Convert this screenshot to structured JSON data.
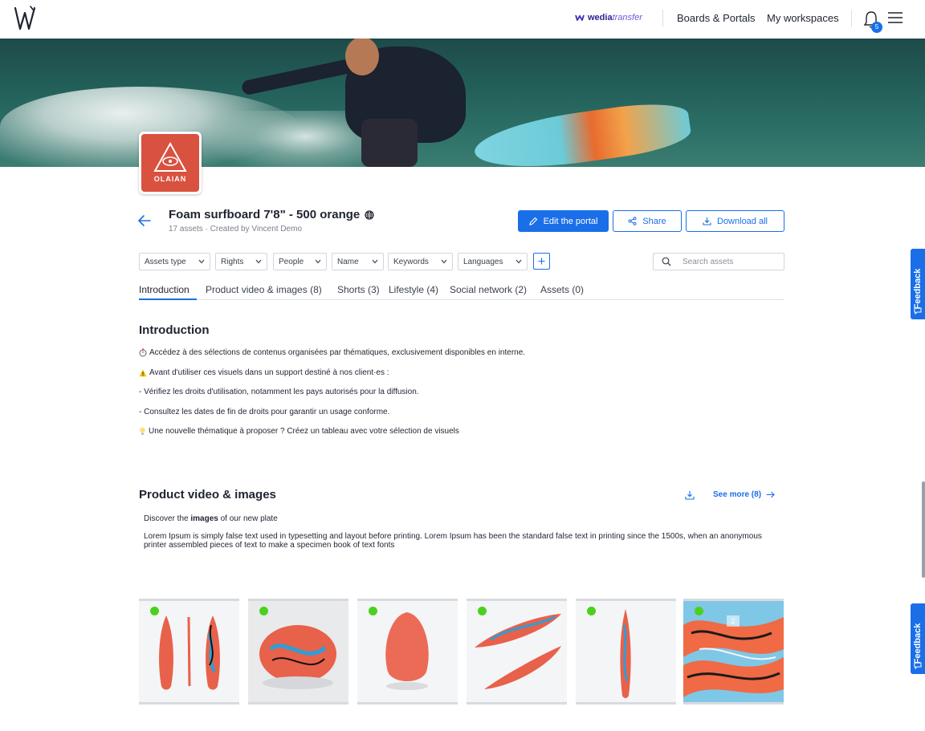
{
  "topbar": {
    "brand_a": "wedia",
    "brand_b": "transfer",
    "nav": [
      "Boards & Portals",
      "My workspaces"
    ],
    "notification_count": "5"
  },
  "portal": {
    "logo_text": "OLAIAN",
    "title": "Foam surfboard 7'8\" - 500 orange",
    "subtitle": "17 assets · Created by Vincent Demo"
  },
  "actions": {
    "edit": "Edit the portal",
    "share": "Share",
    "download": "Download all"
  },
  "filters": [
    "Assets type",
    "Rights",
    "People",
    "Name",
    "Keywords",
    "Languages"
  ],
  "search": {
    "placeholder": "Search assets"
  },
  "tabs": [
    "Introduction",
    "Product video & images (8)",
    "Shorts (3)",
    "Lifestyle (4)",
    "Social network (2)",
    "Assets (0)"
  ],
  "intro": {
    "heading": "Introduction",
    "lines": [
      "Accédez à des sélections de contenus organisées par thématiques, exclusivement disponibles en interne.",
      "Avant d'utiliser ces visuels dans un support destiné à nos client·es :",
      "- Vérifiez les droits d'utilisation, notamment les pays autorisés pour la diffusion.",
      "- Consultez les dates de fin de droits pour garantir un usage conforme.",
      "Une nouvelle thématique à proposer ? Créez un tableau avec votre sélection de visuels"
    ]
  },
  "product": {
    "heading": "Product video & images",
    "see_more": "See more (8)",
    "desc_prefix": "Discover the ",
    "desc_bold": "images",
    "desc_suffix": " of our new plate",
    "lorem": "Lorem Ipsum is simply false text used in typesetting and layout before printing. Lorem Ipsum has been the standard false text in printing since the 1500s, when an anonymous printer assembled pieces of text to make a specimen book of text fonts",
    "thumb_badge": "2"
  },
  "feedback_label": "Feedback",
  "colors": {
    "accent": "#1a6fe8",
    "status_dot": "#4bd11d",
    "brand_red": "#d9513f"
  }
}
